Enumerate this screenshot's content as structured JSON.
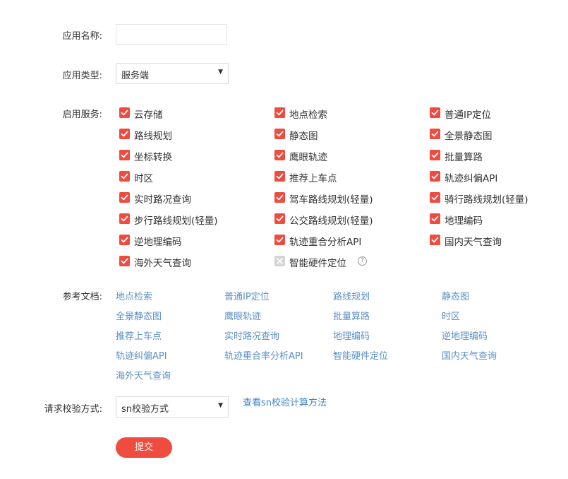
{
  "form": {
    "app_name": {
      "label": "应用名称:",
      "value": ""
    },
    "app_type": {
      "label": "应用类型:",
      "selected": "服务端"
    },
    "services": {
      "label": "启用服务:",
      "items": [
        {
          "label": "云存储",
          "checked": true
        },
        {
          "label": "地点检索",
          "checked": true
        },
        {
          "label": "普通IP定位",
          "checked": true
        },
        {
          "label": "路线规划",
          "checked": true
        },
        {
          "label": "静态图",
          "checked": true
        },
        {
          "label": "全景静态图",
          "checked": true
        },
        {
          "label": "坐标转换",
          "checked": true
        },
        {
          "label": "鹰眼轨迹",
          "checked": true
        },
        {
          "label": "批量算路",
          "checked": true
        },
        {
          "label": "时区",
          "checked": true
        },
        {
          "label": "推荐上车点",
          "checked": true
        },
        {
          "label": "轨迹纠偏API",
          "checked": true
        },
        {
          "label": "实时路况查询",
          "checked": true
        },
        {
          "label": "驾车路线规划(轻量)",
          "checked": true
        },
        {
          "label": "骑行路线规划(轻量)",
          "checked": true
        },
        {
          "label": "步行路线规划(轻量)",
          "checked": true
        },
        {
          "label": "公交路线规划(轻量)",
          "checked": true
        },
        {
          "label": "地理编码",
          "checked": true
        },
        {
          "label": "逆地理编码",
          "checked": true
        },
        {
          "label": "轨迹重合分析API",
          "checked": true
        },
        {
          "label": "国内天气查询",
          "checked": true
        },
        {
          "label": "海外天气查询",
          "checked": true
        },
        {
          "label": "智能硬件定位",
          "checked": false,
          "disabled": true,
          "help": "?"
        }
      ]
    },
    "docs": {
      "label": "参考文档:",
      "links": [
        "地点检索",
        "普通IP定位",
        "路线规划",
        "静态图",
        "全景静态图",
        "鹰眼轨迹",
        "批量算路",
        "时区",
        "推荐上车点",
        "实时路况查询",
        "地理编码",
        "逆地理编码",
        "轨迹纠偏API",
        "轨迹重合率分析API",
        "智能硬件定位",
        "国内天气查询",
        "海外天气查询"
      ]
    },
    "verify": {
      "label": "请求校验方式:",
      "selected": "sn校验方式",
      "link": "查看sn校验计算方法"
    },
    "submit_label": "提交"
  },
  "colors": {
    "accent": "#ef4b3f",
    "link": "#5b8fc6",
    "disabled": "#d4d4d4"
  },
  "icons": {
    "checkbox_checked": "check-icon",
    "checkbox_disabled": "cross-icon",
    "help": "question-circle-icon",
    "select_arrow": "caret-down-icon"
  }
}
